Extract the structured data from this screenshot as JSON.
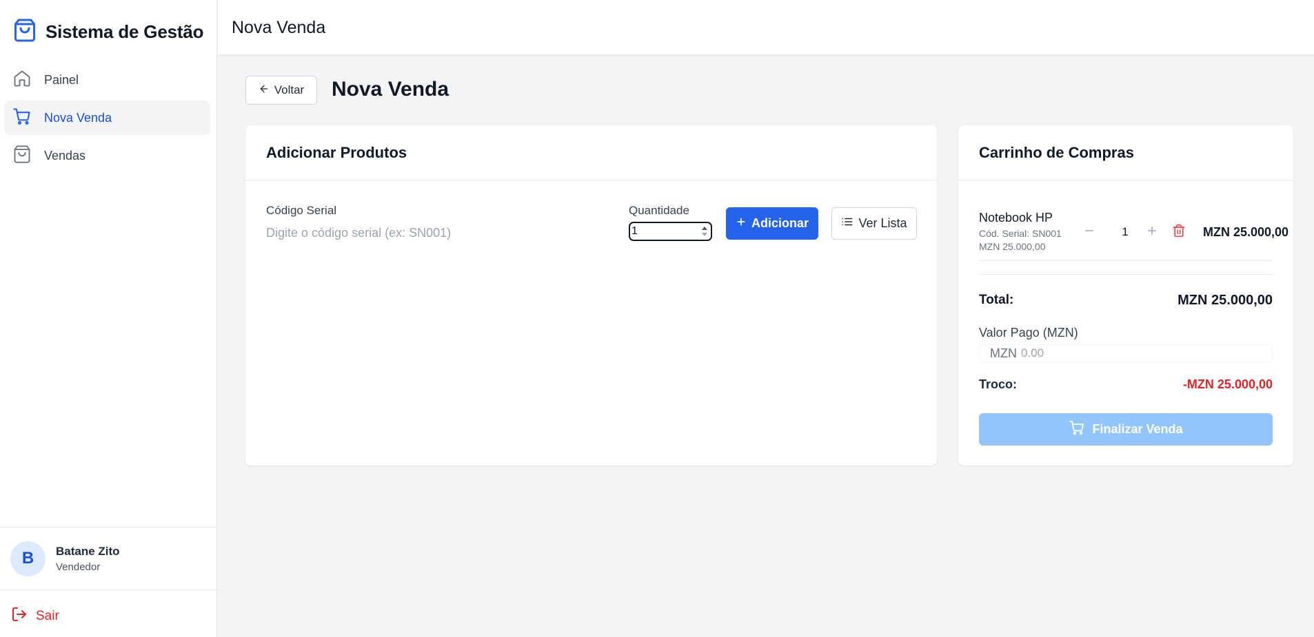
{
  "app": {
    "brand": "Sistema de Gestão",
    "brand_icon": "shopping-bag-icon"
  },
  "sidebar": {
    "items": [
      {
        "label": "Painel",
        "icon": "home-icon",
        "active": false
      },
      {
        "label": "Nova Venda",
        "icon": "cart-icon",
        "active": true
      },
      {
        "label": "Vendas",
        "icon": "shopping-bag-icon",
        "active": false
      }
    ]
  },
  "user": {
    "initial": "B",
    "name": "Batane Zito",
    "role": "Vendedor"
  },
  "logout": {
    "label": "Sair",
    "icon": "logout-icon"
  },
  "topbar": {
    "title": "Nova Venda"
  },
  "page": {
    "back_label": "Voltar",
    "title": "Nova Venda"
  },
  "add_products": {
    "title": "Adicionar Produtos",
    "serial_label": "Código Serial",
    "serial_placeholder": "Digite o código serial (ex: SN001)",
    "serial_value": "",
    "quantity_label": "Quantidade",
    "quantity_value": "1",
    "add_label": "Adicionar",
    "list_label": "Ver Lista"
  },
  "cart": {
    "title": "Carrinho de Compras",
    "items": [
      {
        "name": "Notebook HP",
        "serial": "Cód. Serial: SN001",
        "unit_price": "MZN 25.000,00",
        "qty": "1",
        "total": "MZN 25.000,00"
      }
    ],
    "total_label": "Total:",
    "total_value": "MZN 25.000,00",
    "paid_label": "Valor Pago (MZN)",
    "paid_prefix": "MZN",
    "paid_placeholder": "0.00",
    "change_label": "Troco:",
    "change_value": "-MZN 25.000,00",
    "finish_label": "Finalizar Venda"
  },
  "colors": {
    "primary": "#2563eb",
    "primary_disabled": "#93c5fd",
    "danger": "#dc2626",
    "active_nav": "#1d4ed8"
  }
}
